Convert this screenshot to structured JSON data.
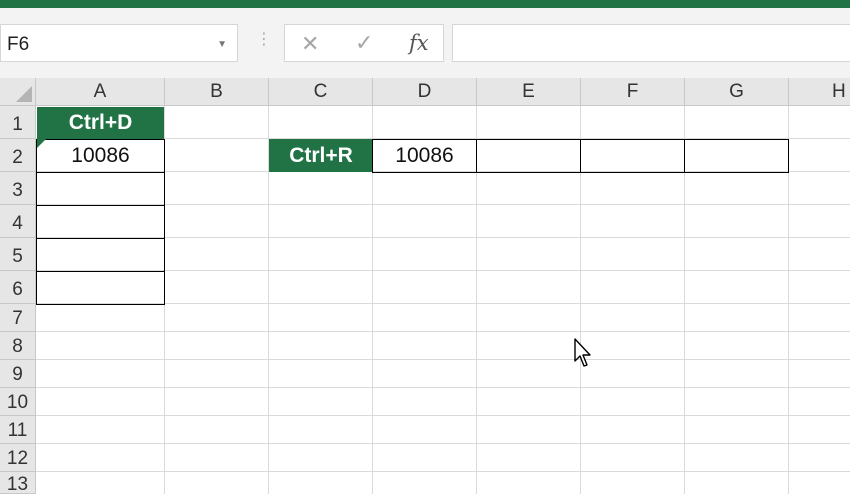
{
  "name_box": {
    "value": "F6"
  },
  "formula_bar": {
    "cancel_symbol": "✕",
    "enter_symbol": "✓",
    "function_symbol": "fx",
    "content": ""
  },
  "columns": [
    "A",
    "B",
    "C",
    "D",
    "E",
    "F",
    "G",
    "H"
  ],
  "rows": [
    "1",
    "2",
    "3",
    "4",
    "5",
    "6",
    "7",
    "8",
    "9",
    "10",
    "11",
    "12",
    "13"
  ],
  "cells": {
    "A1": "Ctrl+D",
    "A2": "10086",
    "C2": "Ctrl+R",
    "D2": "10086"
  },
  "colors": {
    "accent": "#217346",
    "header_bg": "#e6e6e6",
    "gridline": "#dadada"
  }
}
